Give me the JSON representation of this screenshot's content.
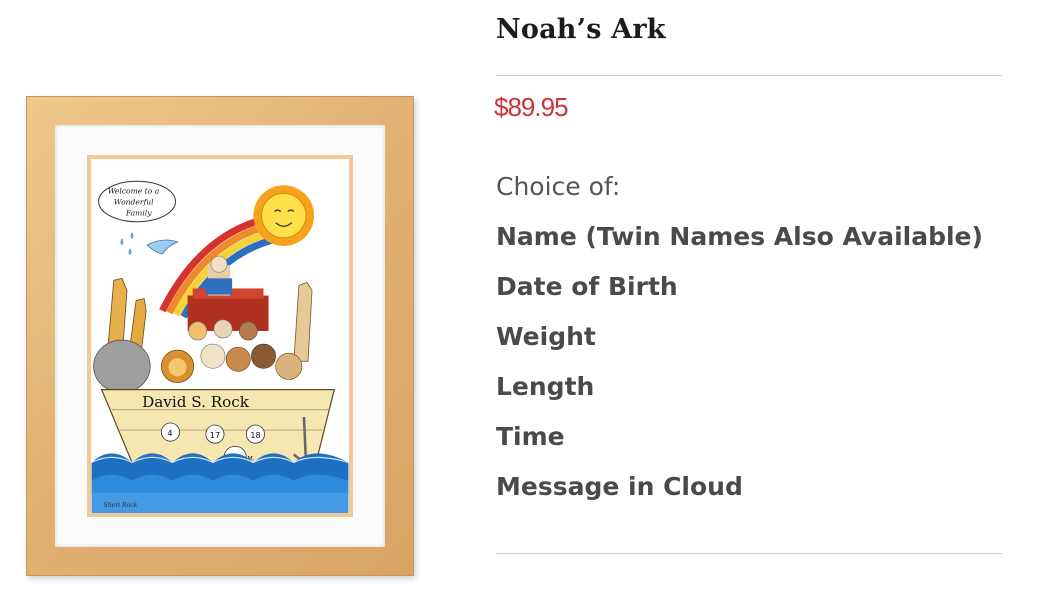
{
  "product": {
    "title": "Noah’s Ark",
    "price": "$89.95",
    "price_color": "#c9353a",
    "choice_label": "Choice of:",
    "options": [
      "Name (Twin Names Also Available)",
      "Date of Birth",
      "Weight",
      "Length",
      "Time",
      "Message in Cloud"
    ]
  },
  "artwork": {
    "cloud_message": [
      "Welcome to a",
      "Wonderful",
      "Family"
    ],
    "name": "David S. Rock",
    "stats": [
      "4",
      "17",
      "18"
    ],
    "time_badge": "2:21 A.M.",
    "artist_signature": "Sheri Rock"
  }
}
